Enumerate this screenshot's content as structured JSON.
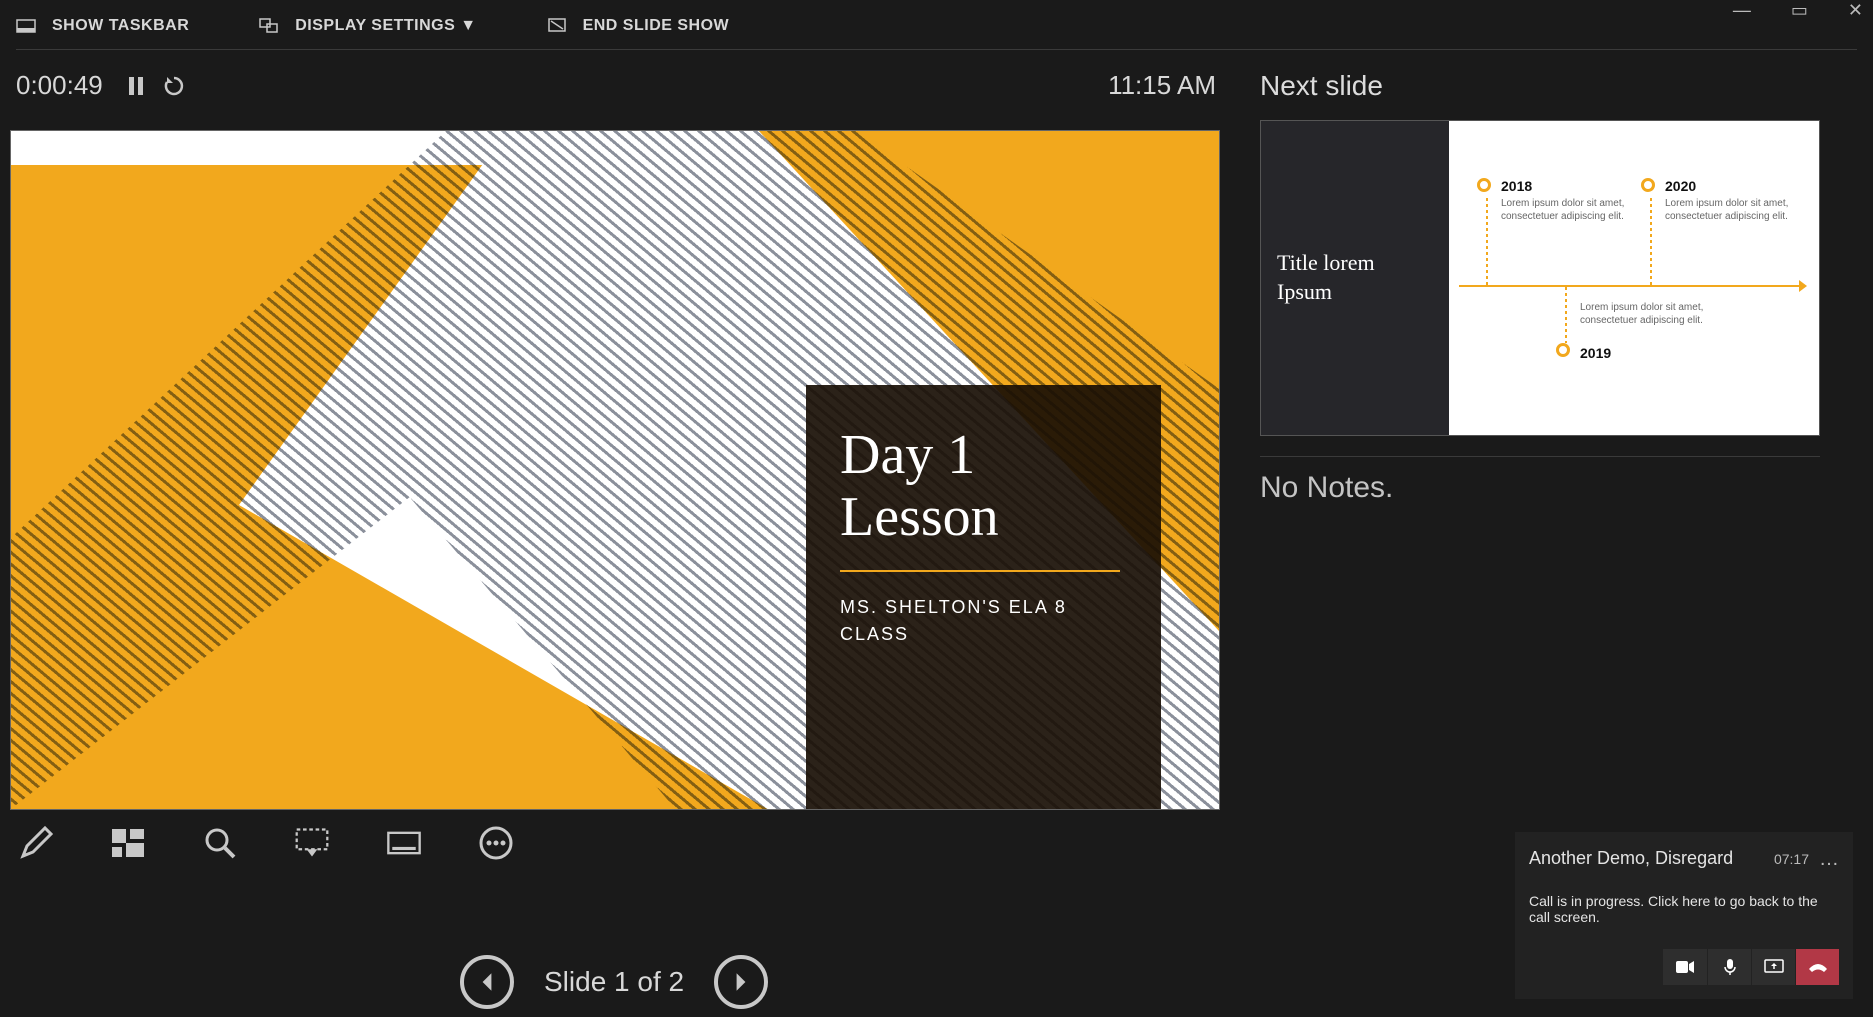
{
  "topbar": {
    "show_taskbar": "SHOW TASKBAR",
    "display_settings": "DISPLAY SETTINGS ▼",
    "end_show": "END SLIDE SHOW"
  },
  "timer": {
    "elapsed": "0:00:49",
    "clock": "11:15 AM"
  },
  "slide": {
    "title_line1": "Day 1",
    "title_line2": "Lesson",
    "subtitle": "MS. SHELTON'S ELA 8 CLASS"
  },
  "nav": {
    "counter": "Slide 1 of 2"
  },
  "right": {
    "next_label": "Next slide",
    "next_title": "Title lorem Ipsum",
    "timeline": {
      "y1": "2018",
      "y2": "2020",
      "y3": "2019",
      "desc": "Lorem ipsum dolor sit amet, consectetuer adipiscing elit."
    },
    "no_notes": "No Notes."
  },
  "teams": {
    "title": "Another Demo, Disregard",
    "time": "07:17",
    "message": "Call is in progress. Click here to go back to the call screen."
  }
}
